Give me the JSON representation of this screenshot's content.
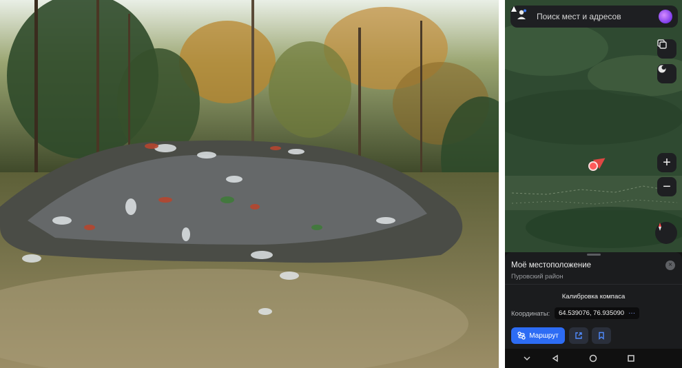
{
  "map": {
    "search": {
      "placeholder": "Поиск мест и адресов"
    },
    "buttons": {
      "zoom_in": "+",
      "zoom_out": "−"
    }
  },
  "sheet": {
    "title": "Моё местоположение",
    "subtitle": "Пуровский район",
    "close_glyph": "×",
    "calibration": "Калибровка компаса",
    "coordinates_label": "Координаты:",
    "coordinates_value": "64.539076, 76.935090",
    "coordinates_more": "···",
    "route_label": "Маршрут"
  },
  "colors": {
    "accent_blue": "#2d6cf4",
    "sheet_bg": "#1b1c1e",
    "marker_red": "#ff5a5a",
    "alice_purple": "#7d3bea"
  },
  "icons": {
    "profile": "person-icon",
    "alice": "alice-assistant-icon",
    "layers": "layers-icon",
    "weather": "weather-icon",
    "compass": "compass-icon",
    "route": "route-icon",
    "share": "share-icon",
    "bookmark": "bookmark-icon",
    "nav_down": "chevron-down-icon",
    "nav_back": "back-triangle-icon",
    "nav_home": "home-circle-icon",
    "nav_recents": "recents-square-icon"
  }
}
